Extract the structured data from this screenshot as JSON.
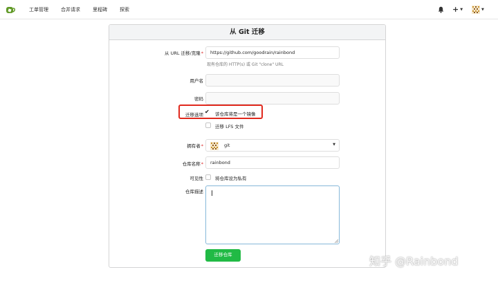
{
  "nav": {
    "items": [
      "工单管理",
      "合并请求",
      "里程碑",
      "探索"
    ]
  },
  "colors": {
    "accent": "#21ba45",
    "brand": "#609926",
    "highlight": "#e0281c"
  },
  "form": {
    "title": "从 Git 迁移",
    "clone_url_label": "从 URL 迁移/克隆",
    "clone_url_value": "https://github.com/goodrain/rainbond",
    "clone_url_help": "现有仓库的 HTTP(s) 或 Git \"clone\" URL",
    "username_label": "用户名",
    "username_value": "",
    "password_label": "密码",
    "password_value": "",
    "migrate_options_label": "迁移选项",
    "mirror_label": "该仓库将是一个镜像",
    "mirror_checked": true,
    "lfs_label": "迁移 LFS 文件",
    "lfs_checked": false,
    "owner_label": "拥有者",
    "owner_value": "git",
    "repo_name_label": "仓库名称",
    "repo_name_value": "rainbond",
    "visibility_label": "可见性",
    "private_label": "将仓库设为私有",
    "private_checked": false,
    "description_label": "仓库描述",
    "description_value": "",
    "submit_label": "迁移仓库"
  },
  "watermark": "知乎 @Rainbond"
}
